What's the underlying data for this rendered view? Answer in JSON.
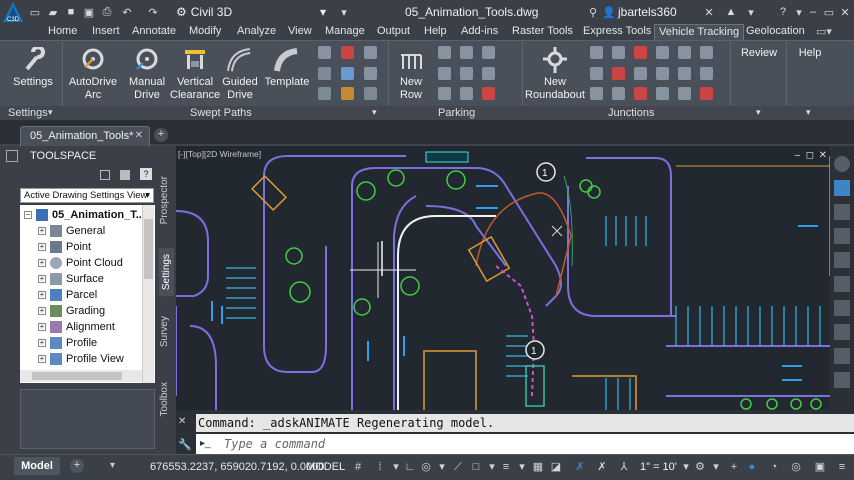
{
  "app": {
    "logo_text": "C3D",
    "workspace": "Civil 3D",
    "document_title": "05_Animation_Tools.dwg",
    "user": "jbartels360"
  },
  "ribbon_tabs": [
    "Home",
    "Insert",
    "Annotate",
    "Modify",
    "Analyze",
    "View",
    "Manage",
    "Output",
    "Help",
    "Add-ins",
    "Raster Tools",
    "Express Tools",
    "Vehicle Tracking",
    "Geolocation"
  ],
  "active_tab": "Vehicle Tracking",
  "ribbon": {
    "settings": {
      "label": "Settings",
      "panel": "Settings"
    },
    "swept_paths": {
      "panel": "Swept Paths",
      "buttons": [
        "AutoDrive Arc",
        "Manual Drive",
        "Vertical Clearance",
        "Guided Drive",
        "Template"
      ]
    },
    "parking": {
      "panel": "Parking",
      "buttons": [
        "New Row"
      ]
    },
    "junctions": {
      "panel": "Junctions",
      "buttons": [
        "New Roundabout"
      ]
    },
    "review": {
      "label": "Review"
    },
    "help": {
      "label": "Help"
    }
  },
  "document_tab": "05_Animation_Tools*",
  "toolspace": {
    "title": "TOOLSPACE",
    "view": "Active Drawing Settings View",
    "root": "05_Animation_T...",
    "items": [
      "General",
      "Point",
      "Point Cloud",
      "Surface",
      "Parcel",
      "Grading",
      "Alignment",
      "Profile",
      "Profile View"
    ],
    "side_tabs": [
      "Prospector",
      "Settings",
      "Survey",
      "Toolbox"
    ]
  },
  "viewport": {
    "label": "[-][Top][2D Wireframe]",
    "markers": [
      "1",
      "1"
    ]
  },
  "command": {
    "history": "Command: _adskANIMATE Regenerating model.",
    "placeholder": "Type a command"
  },
  "status": {
    "layout_tab": "Model",
    "coords": "676553.2237, 659020.7192, 0.0000",
    "mode": "MODEL",
    "scale": "1\" = 10'"
  },
  "colors": {
    "accent": "#1b75bb",
    "drawing_bg": "#212830",
    "ribbon_bg": "#4a505a"
  }
}
